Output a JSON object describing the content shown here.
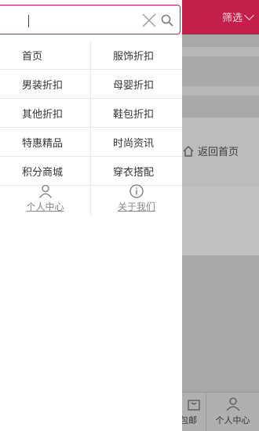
{
  "header": {
    "filter_label": "筛选",
    "filter_icon": "chevron-down-icon",
    "accent": "#c41e4a"
  },
  "background": {
    "back_home_label": "返回首页"
  },
  "bottom_tabs": [
    {
      "label": "包邮",
      "icon": "bag-icon"
    },
    {
      "label": "个人中心",
      "icon": "user-icon"
    }
  ],
  "search": {
    "value": "",
    "placeholder": "",
    "clear_icon": "close-icon",
    "search_icon": "search-icon"
  },
  "menu": {
    "rows": [
      {
        "left": "首页",
        "right": "服饰折扣"
      },
      {
        "left": "男装折扣",
        "right": "母婴折扣"
      },
      {
        "left": "其他折扣",
        "right": "鞋包折扣"
      },
      {
        "left": "特惠精品",
        "right": "时尚资讯"
      },
      {
        "left": "积分商城",
        "right": "穿衣搭配"
      }
    ]
  },
  "links": {
    "profile": {
      "label": "个人中心",
      "icon": "user-icon"
    },
    "about": {
      "label": "关于我们",
      "icon": "info-icon"
    }
  }
}
